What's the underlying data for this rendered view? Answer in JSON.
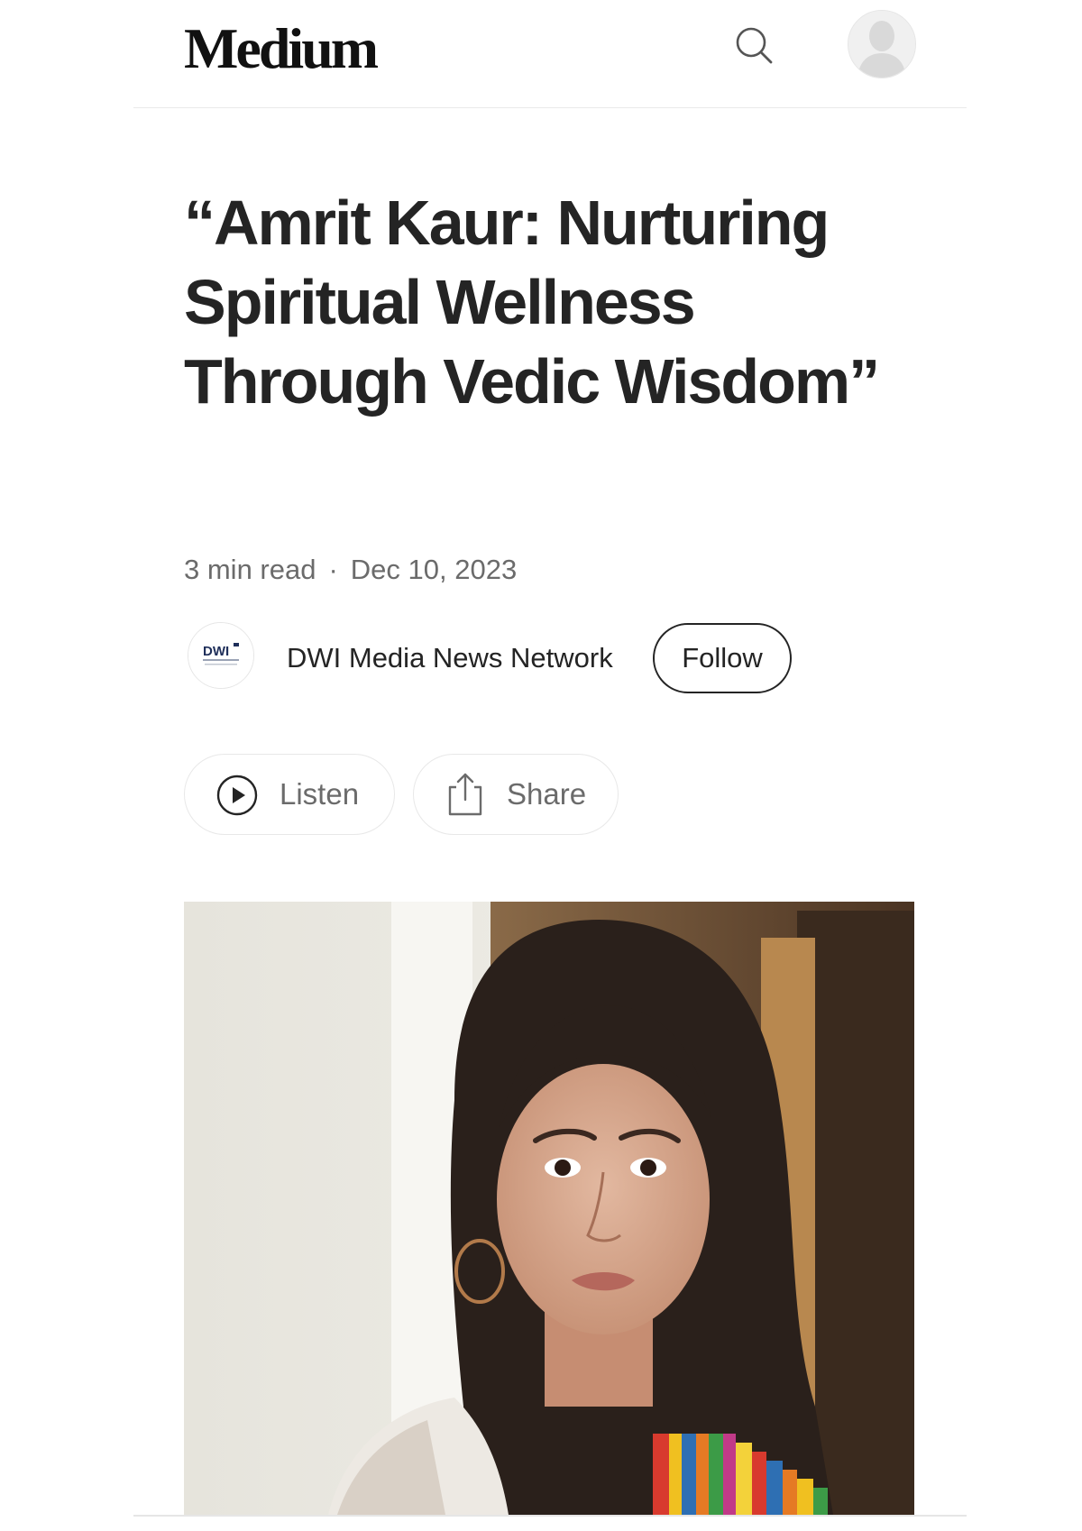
{
  "header": {
    "logo_text": "Medium",
    "search_icon": "search-icon",
    "avatar_icon": "user-avatar-icon"
  },
  "article": {
    "title": "“Amrit Kaur: Nurturing Spiritual Wellness Through Vedic Wisdom”",
    "read_time": "3 min read",
    "separator": "·",
    "date": "Dec 10, 2023"
  },
  "author": {
    "name": "DWI Media News Network",
    "logo_text": "DWI",
    "follow_label": "Follow"
  },
  "actions": {
    "listen_label": "Listen",
    "listen_icon": "play-circle-icon",
    "share_label": "Share",
    "share_icon": "share-icon"
  },
  "colors": {
    "text_primary": "#242424",
    "text_secondary": "#6b6b6b",
    "border": "#e8e8e8"
  }
}
